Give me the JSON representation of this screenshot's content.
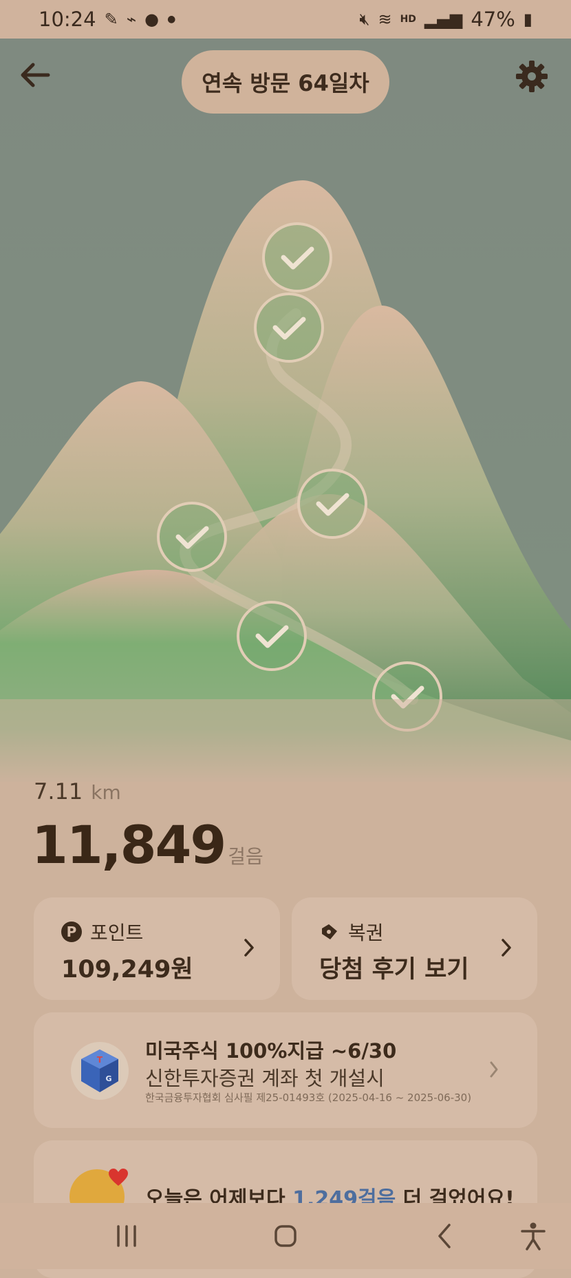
{
  "status": {
    "time": "10:24",
    "notif_icons": [
      "pen-icon",
      "shoe-icon",
      "bubble-icon",
      "dot-icon"
    ],
    "battery": "47%",
    "system_icons": [
      "mute-icon",
      "wifi-icon",
      "hd-voice-icon",
      "signal-icon",
      "battery-icon"
    ]
  },
  "header": {
    "visit_label": "연속 방문 64일차"
  },
  "stats": {
    "distance_value": "7.11",
    "distance_unit": "km",
    "steps_value": "11,849",
    "steps_unit": "걸음"
  },
  "cards": {
    "point_label": "포인트",
    "point_badge": "P",
    "point_value": "109,249원",
    "lotto_label": "복권",
    "lotto_value": "당첨 후기 보기"
  },
  "ad": {
    "title": "미국주식 100%지급 ~6/30",
    "subtitle": "신한투자증권 계좌 첫 개설시",
    "note": "한국금융투자협회 심사필 제25-01493호 (2025-04-16 ~ 2025-06-30)"
  },
  "today": {
    "text_before": "오늘은 어제보다 ",
    "highlight": "1,249걸음",
    "text_after": " 더 걸었어요!"
  },
  "colors": {
    "sky": "#7e8b80",
    "mountain_green": "#5f9a66",
    "mountain_peak": "#cdb29c",
    "accent_blue": "#4e6e9e",
    "text_dark": "#3d2b1c"
  }
}
